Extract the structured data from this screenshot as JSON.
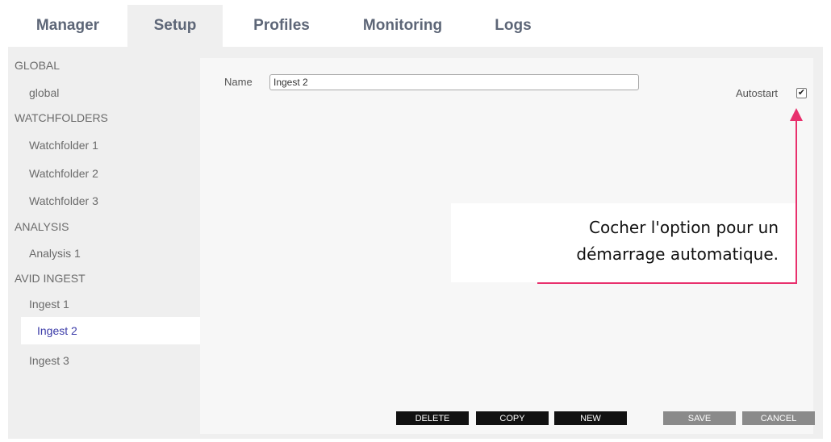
{
  "tabs": [
    {
      "label": "Manager"
    },
    {
      "label": "Setup"
    },
    {
      "label": "Profiles"
    },
    {
      "label": "Monitoring"
    },
    {
      "label": "Logs"
    }
  ],
  "sidebar": {
    "items": [
      {
        "label": "GLOBAL"
      },
      {
        "label": "global"
      },
      {
        "label": "WATCHFOLDERS"
      },
      {
        "label": "Watchfolder 1"
      },
      {
        "label": "Watchfolder 2"
      },
      {
        "label": "Watchfolder 3"
      },
      {
        "label": "ANALYSIS"
      },
      {
        "label": "Analysis 1"
      },
      {
        "label": "AVID INGEST"
      },
      {
        "label": "Ingest 1"
      },
      {
        "label": "Ingest 2"
      },
      {
        "label": "Ingest 3"
      }
    ]
  },
  "form": {
    "name_label": "Name",
    "name_value": "Ingest 2",
    "autostart_label": "Autostart",
    "autostart_checked": true
  },
  "annotation": {
    "line1": "Cocher l'option pour un",
    "line2": "démarrage automatique.",
    "color": "#e8306d"
  },
  "buttons": {
    "delete": "DELETE",
    "copy": "COPY",
    "new": "NEW",
    "save": "SAVE",
    "cancel": "CANCEL"
  }
}
